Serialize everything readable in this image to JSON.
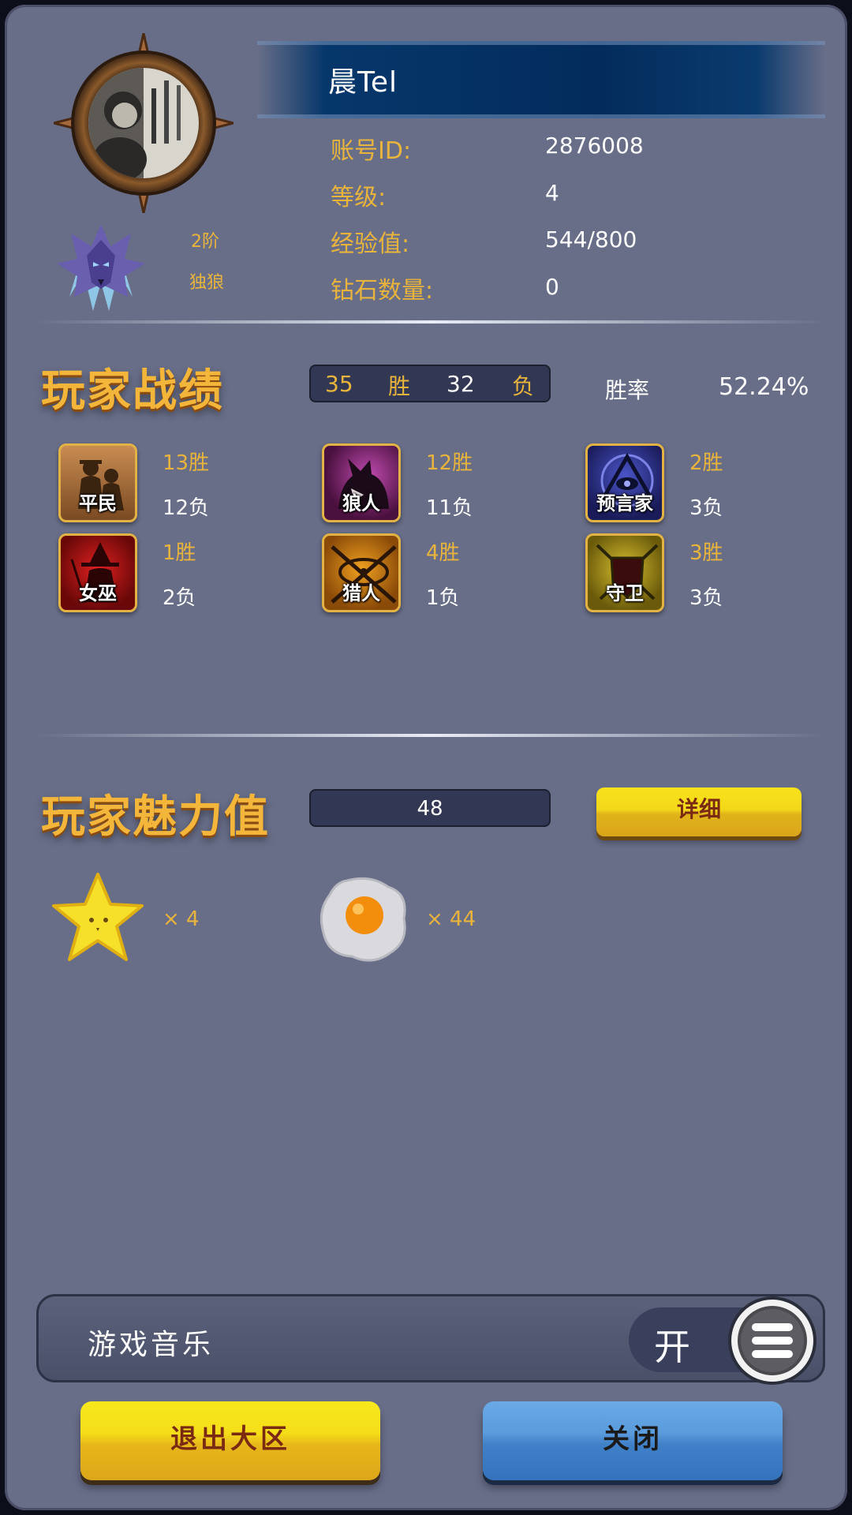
{
  "profile": {
    "name": "晨Tel",
    "account_label": "账号ID:",
    "account_value": "2876008",
    "level_label": "等级:",
    "level_value": "4",
    "exp_label": "经验值:",
    "exp_value": "544/800",
    "diamond_label": "钻石数量:",
    "diamond_value": "0",
    "rank_tier": "2阶",
    "rank_title": "独狼"
  },
  "record": {
    "title": "玩家战绩",
    "wins": "35",
    "wins_label": "胜",
    "losses": "32",
    "losses_label": "负",
    "rate_label": "胜率",
    "rate_value": "52.24%"
  },
  "roles": [
    {
      "name": "平民",
      "wins": "13胜",
      "losses": "12负"
    },
    {
      "name": "狼人",
      "wins": "12胜",
      "losses": "11负"
    },
    {
      "name": "预言家",
      "wins": "2胜",
      "losses": "3负"
    },
    {
      "name": "女巫",
      "wins": "1胜",
      "losses": "2负"
    },
    {
      "name": "猎人",
      "wins": "4胜",
      "losses": "1负"
    },
    {
      "name": "守卫",
      "wins": "3胜",
      "losses": "3负"
    }
  ],
  "charm": {
    "title": "玩家魅力值",
    "value": "48",
    "detail_label": "详细",
    "gifts": [
      {
        "icon": "star-icon",
        "count": "× 4"
      },
      {
        "icon": "egg-icon",
        "count": "× 44"
      }
    ]
  },
  "settings": {
    "music_label": "游戏音乐",
    "music_state": "开"
  },
  "buttons": {
    "exit": "退出大区",
    "close": "关闭"
  },
  "colors": {
    "panel": "#686e88",
    "accent_gold": "#e9b43c",
    "banner": "#06376b"
  }
}
